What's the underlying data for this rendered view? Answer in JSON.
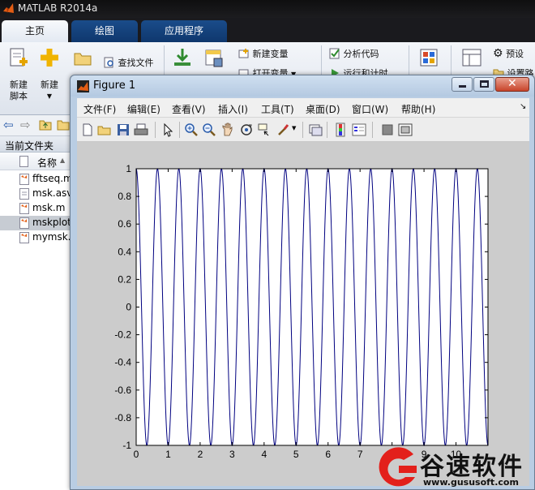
{
  "app": {
    "title": "MATLAB R2014a"
  },
  "ribbon_tabs": [
    "主页",
    "绘图",
    "应用程序"
  ],
  "ribbon": {
    "new_script": [
      "新建",
      "脚本"
    ],
    "new": "新建",
    "find_files": "查找文件",
    "new_variable": "新建变量",
    "open_variable": "打开变量",
    "analyze_code": "分析代码",
    "run_and_time": "运行和计时",
    "preferences": "预设",
    "set_path": "设置路"
  },
  "left_panel": {
    "header": "当前文件夹",
    "column_name": "名称",
    "files": [
      {
        "name": "fftseq.m",
        "type": "m",
        "selected": false
      },
      {
        "name": "msk.asv",
        "type": "asv",
        "selected": false
      },
      {
        "name": "msk.m",
        "type": "m",
        "selected": false
      },
      {
        "name": "mskplot.m",
        "type": "m",
        "selected": true
      },
      {
        "name": "mymsk.m",
        "type": "m",
        "selected": false
      }
    ]
  },
  "figure": {
    "title": "Figure 1",
    "menu": [
      "文件(F)",
      "编辑(E)",
      "查看(V)",
      "插入(I)",
      "工具(T)",
      "桌面(D)",
      "窗口(W)",
      "帮助(H)"
    ],
    "toolbar_icons": [
      "new-icon",
      "open-icon",
      "save-icon",
      "print-icon",
      "pointer-icon",
      "zoom-in-icon",
      "zoom-out-icon",
      "pan-icon",
      "rotate-icon",
      "data-cursor-icon",
      "brush-icon",
      "link-plot-icon",
      "colorbar-icon",
      "legend-icon",
      "hide-plot-tools-icon",
      "show-plot-tools-icon"
    ]
  },
  "chart_data": {
    "type": "line",
    "title": "",
    "xlabel": "",
    "ylabel": "",
    "xlim": [
      0,
      11
    ],
    "ylim": [
      -1,
      1
    ],
    "xticks": [
      0,
      1,
      2,
      3,
      4,
      5,
      6,
      7,
      8,
      9,
      10
    ],
    "yticks": [
      -1,
      -0.8,
      -0.6,
      -0.4,
      -0.2,
      0,
      0.2,
      0.4,
      0.6,
      0.8,
      1
    ],
    "grid": false,
    "line_color": "#000080",
    "series": [
      {
        "function": "cos",
        "frequency": 1.5,
        "phase": 0,
        "x_start": 0,
        "x_end": 11,
        "samples": 1100
      }
    ]
  },
  "watermark": {
    "text": "谷速软件",
    "url": "www.gususoft.com"
  }
}
